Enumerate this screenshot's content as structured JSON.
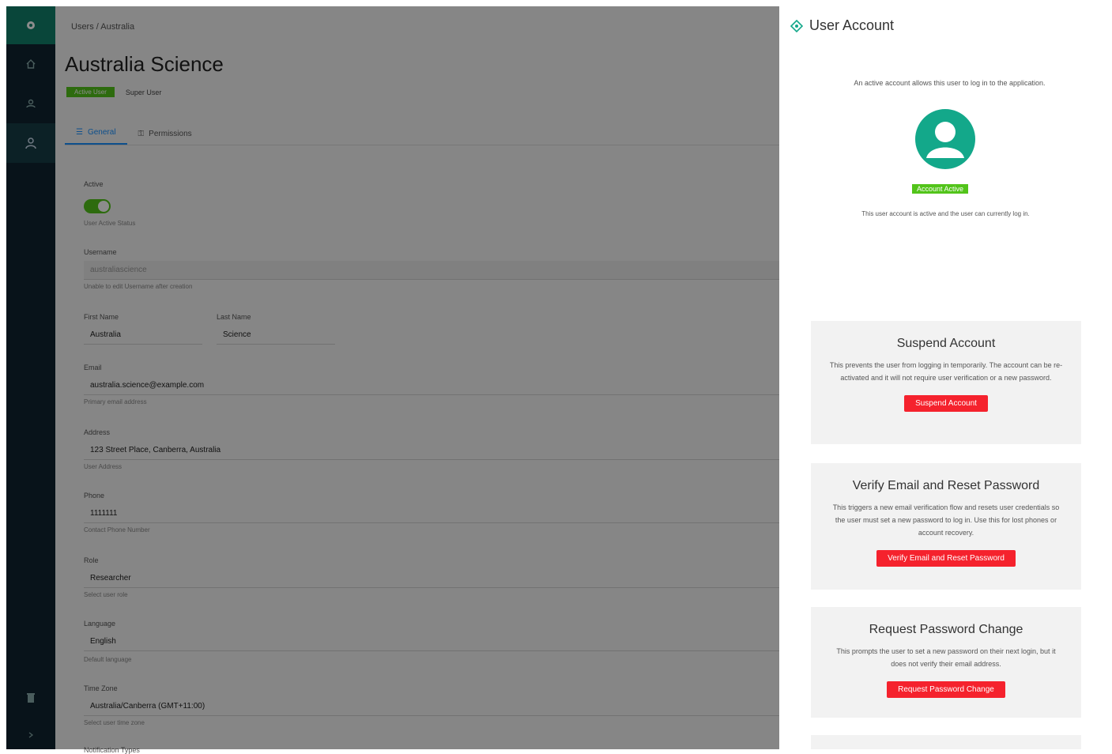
{
  "colors": {
    "sidebar": "#0f2430",
    "brand": "#11806a",
    "active_green": "#52c41a",
    "danger": "#f5222d",
    "tab_active": "#1890ff"
  },
  "sidebar": {
    "icons": [
      "gear-icon",
      "home-icon",
      "group-icon",
      "user-icon",
      "trash-icon",
      "chevron-icon"
    ]
  },
  "main": {
    "breadcrumb": "Users / Australia",
    "title": "Australia Science",
    "badge": "Active User",
    "status_sub": "Super User",
    "tabs": [
      "General",
      "Permissions"
    ],
    "form": {
      "active_label": "Active",
      "active_help": "User Active Status",
      "username_label": "Username",
      "username_value": "australiascience",
      "username_help": "Unable to edit Username after creation",
      "first_name_label": "First Name",
      "first_name_value": "Australia",
      "last_name_label": "Last Name",
      "last_name_value": "Science",
      "email_label": "Email",
      "email_value": "australia.science@example.com",
      "email_help": "Primary email address",
      "address_label": "Address",
      "address_value": "123 Street Place, Canberra, Australia",
      "address_help": "User Address",
      "phone_label": "Phone",
      "phone_value": "1111111",
      "phone_help": "Contact Phone Number",
      "role_label": "Role",
      "role_value": "Researcher",
      "role_help": "Select user role",
      "language_label": "Language",
      "language_value": "English",
      "language_help": "Default language",
      "timezone_label": "Time Zone",
      "timezone_value": "Australia/Canberra (GMT+11:00)",
      "timezone_help": "Select user time zone",
      "last_label": "Notification Types"
    }
  },
  "drawer": {
    "title": "User Account",
    "intro": "An active account allows this user to log in to the application.",
    "badge": "Account Active",
    "note": "This user account is active and the user can currently log in.",
    "cards": [
      {
        "title": "Suspend Account",
        "text": "This prevents the user from logging in temporarily. The account can be re-activated and it will not require user verification or a new password.",
        "button": "Suspend Account"
      },
      {
        "title": "Verify Email and Reset Password",
        "text": "This triggers a new email verification flow and resets user credentials so the user must set a new password to log in. Use this for lost phones or account recovery.",
        "button": "Verify Email and Reset Password"
      },
      {
        "title": "Request Password Change",
        "text": "This prompts the user to set a new password on their next login, but it does not verify their email address.",
        "button": "Request Password Change"
      }
    ]
  }
}
